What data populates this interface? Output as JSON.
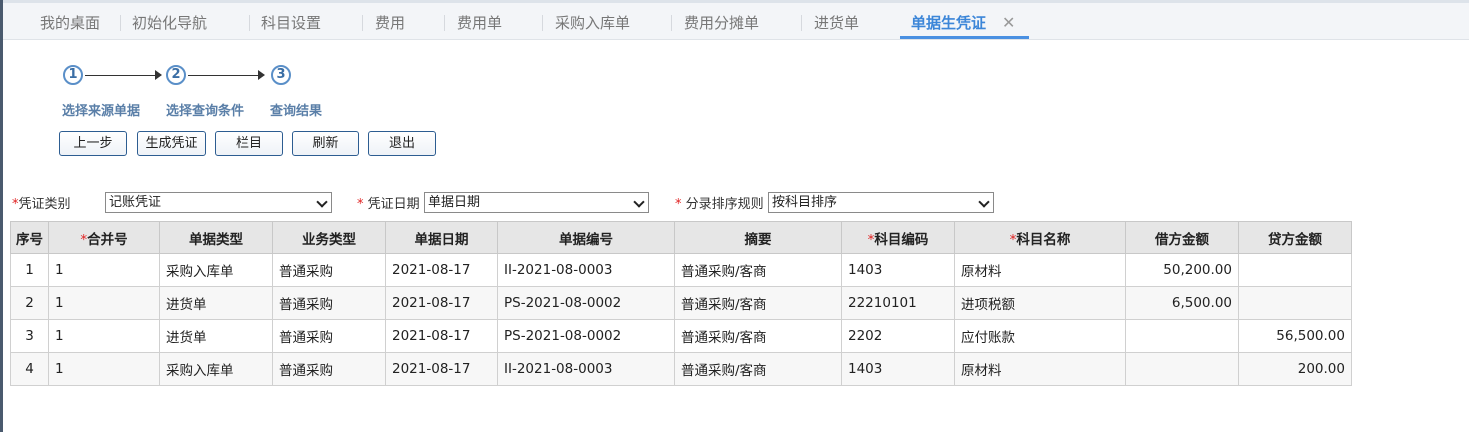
{
  "tabs": [
    {
      "label": "我的桌面"
    },
    {
      "label": "初始化导航"
    },
    {
      "label": "科目设置"
    },
    {
      "label": "费用"
    },
    {
      "label": "费用单"
    },
    {
      "label": "采购入库单"
    },
    {
      "label": "费用分摊单"
    },
    {
      "label": "进货单"
    },
    {
      "label": "单据生凭证"
    }
  ],
  "active_tab_close": "✕",
  "steps": [
    {
      "num": "1",
      "label": "选择来源单据"
    },
    {
      "num": "2",
      "label": "选择查询条件"
    },
    {
      "num": "3",
      "label": "查询结果"
    }
  ],
  "buttons": {
    "prev": "上一步",
    "generate": "生成凭证",
    "columns": "栏目",
    "refresh": "刷新",
    "exit": "退出"
  },
  "form": {
    "voucher_type_label": "凭证类别",
    "voucher_type_value": "记账凭证",
    "voucher_date_label": "凭证日期",
    "voucher_date_value": "单据日期",
    "sort_rule_label": "分录排序规则",
    "sort_rule_value": "按科目排序",
    "required_mark": "*"
  },
  "table": {
    "headers": {
      "seq": "序号",
      "merge_no": "合并号",
      "doc_type": "单据类型",
      "biz_type": "业务类型",
      "doc_date": "单据日期",
      "doc_no": "单据编号",
      "summary": "摘要",
      "account_code": "科目编码",
      "account_name": "科目名称",
      "debit": "借方金额",
      "credit": "贷方金额"
    },
    "rows": [
      {
        "seq": "1",
        "merge_no": "1",
        "doc_type": "采购入库单",
        "biz_type": "普通采购",
        "doc_date": "2021-08-17",
        "doc_no": "II-2021-08-0003",
        "summary": "普通采购/客商",
        "account_code": "1403",
        "account_name": "原材料",
        "debit": "50,200.00",
        "credit": ""
      },
      {
        "seq": "2",
        "merge_no": "1",
        "doc_type": "进货单",
        "biz_type": "普通采购",
        "doc_date": "2021-08-17",
        "doc_no": "PS-2021-08-0002",
        "summary": "普通采购/客商",
        "account_code": "22210101",
        "account_name": "进项税额",
        "debit": "6,500.00",
        "credit": ""
      },
      {
        "seq": "3",
        "merge_no": "1",
        "doc_type": "进货单",
        "biz_type": "普通采购",
        "doc_date": "2021-08-17",
        "doc_no": "PS-2021-08-0002",
        "summary": "普通采购/客商",
        "account_code": "2202",
        "account_name": "应付账款",
        "debit": "",
        "credit": "56,500.00"
      },
      {
        "seq": "4",
        "merge_no": "1",
        "doc_type": "采购入库单",
        "biz_type": "普通采购",
        "doc_date": "2021-08-17",
        "doc_no": "II-2021-08-0003",
        "summary": "普通采购/客商",
        "account_code": "1403",
        "account_name": "原材料",
        "debit": "",
        "credit": "200.00"
      }
    ]
  },
  "colors": {
    "active_tab": "#3c86d8",
    "required": "#e02020",
    "step": "#5a8fc8",
    "button_border": "#2d5d91"
  }
}
